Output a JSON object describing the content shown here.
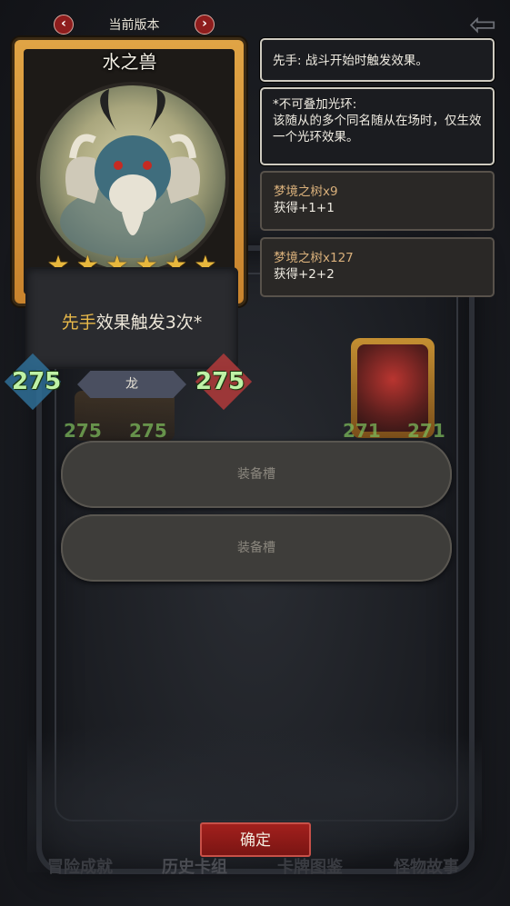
{
  "version": {
    "title": "当前版本",
    "prev_icon": "chevron-left-icon",
    "next_icon": "chevron-right-icon"
  },
  "card": {
    "name": "水之兽",
    "stars": 6,
    "effect_keyword": "先手",
    "effect_rest": "效果触发3次*",
    "attack": "275",
    "health": "275",
    "tribe": "龙"
  },
  "info": {
    "line1": "先手: 战斗开始时触发效果。",
    "aura_title": "*不可叠加光环:",
    "aura_desc": "该随从的多个同名随从在场时，仅生效一个光环效果。"
  },
  "trees": [
    {
      "name": "梦境之树x9",
      "effect": "获得+1+1"
    },
    {
      "name": "梦境之树x127",
      "effect": "获得+2+2"
    }
  ],
  "background_cards": {
    "left": {
      "attack": "275",
      "health": "275"
    },
    "right": {
      "attack": "271",
      "health": "271"
    }
  },
  "slots": [
    "装备槽",
    "装备槽"
  ],
  "confirm_label": "确定",
  "bottom_tabs": [
    "冒险成就",
    "历史卡组",
    "卡牌图鉴",
    "怪物故事"
  ],
  "colors": {
    "accent_gold": "#e8b94a",
    "stat_green": "#bff2a6",
    "confirm_red": "#a2201d",
    "card_frame": "#e0a445"
  }
}
